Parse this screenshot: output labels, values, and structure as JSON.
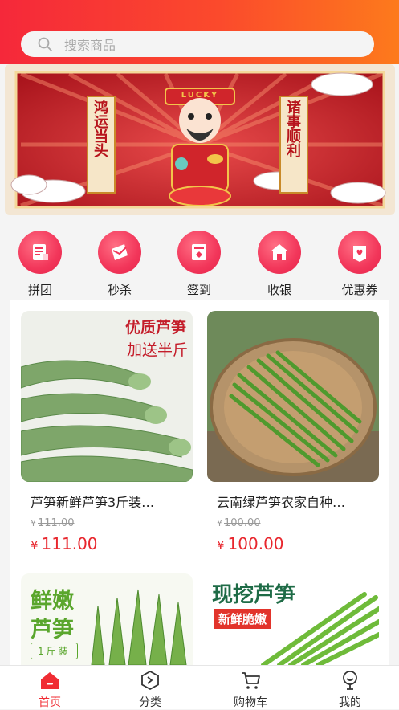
{
  "colors": {
    "accent": "#f02c33",
    "header_start": "#f5283a",
    "header_end": "#fd7a1c",
    "price": "#e8262d"
  },
  "search": {
    "placeholder": "搜索商品",
    "icon": "search-icon"
  },
  "banner": {
    "left_couplet": "鸿运当头",
    "right_couplet": "诸事顺利",
    "hat_text": "LUCKY"
  },
  "categories": [
    {
      "label": "拼团",
      "icon": "group-buy-icon"
    },
    {
      "label": "秒杀",
      "icon": "flash-sale-icon"
    },
    {
      "label": "签到",
      "icon": "check-in-icon"
    },
    {
      "label": "收银",
      "icon": "cashier-icon"
    },
    {
      "label": "优惠券",
      "icon": "coupon-icon"
    }
  ],
  "products": [
    {
      "title": "芦笋新鲜芦笋3斤装…",
      "old_price": "111.00",
      "price": "111.00",
      "currency": "¥",
      "image_text_1": "优质芦笋",
      "image_text_2": "加送半斤"
    },
    {
      "title": "云南绿芦笋农家自种…",
      "old_price": "100.00",
      "price": "100.00",
      "currency": "¥"
    },
    {
      "title": "",
      "image_text_1": "鲜嫩",
      "image_text_2": "芦笋",
      "image_text_3": "1斤装"
    },
    {
      "title": "",
      "image_text_1": "现挖芦笋",
      "image_text_2": "新鲜脆嫩"
    }
  ],
  "tabs": [
    {
      "label": "首页",
      "icon": "home-icon",
      "active": true
    },
    {
      "label": "分类",
      "icon": "category-icon",
      "active": false
    },
    {
      "label": "购物车",
      "icon": "cart-icon",
      "active": false
    },
    {
      "label": "我的",
      "icon": "profile-icon",
      "active": false
    }
  ]
}
